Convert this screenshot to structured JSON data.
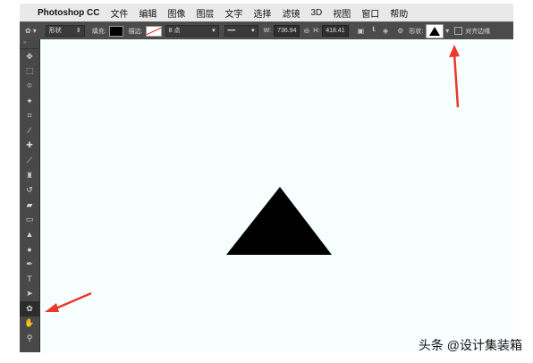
{
  "menubar": {
    "apple": "",
    "app": "Photoshop CC",
    "items": [
      "文件",
      "编辑",
      "图像",
      "图层",
      "文字",
      "选择",
      "滤镜",
      "3D",
      "视图",
      "窗口",
      "帮助"
    ]
  },
  "options": {
    "mode": "形状",
    "fill_label": "填充:",
    "stroke_label": "描边:",
    "stroke_width": "8 点",
    "w_label": "W:",
    "w_value": "736.94",
    "h_label": "H:",
    "h_value": "418.41",
    "shape_label": "形状:",
    "align_label": "对齐边缘"
  },
  "tools": [
    "move-tool",
    "marquee-tool",
    "lasso-tool",
    "magic-wand-tool",
    "crop-tool",
    "eyedropper-tool",
    "healing-brush-tool",
    "brush-tool",
    "clone-stamp-tool",
    "history-brush-tool",
    "eraser-tool",
    "gradient-tool",
    "blur-tool",
    "dodge-tool",
    "pen-tool",
    "type-tool",
    "path-selection-tool",
    "custom-shape-tool",
    "hand-tool",
    "zoom-tool"
  ],
  "colors": {
    "annotation_arrow": "#e8392c",
    "canvas_bg": "#f7fefe",
    "shape_fill": "#000000"
  },
  "watermark": "头条 @设计集装箱"
}
